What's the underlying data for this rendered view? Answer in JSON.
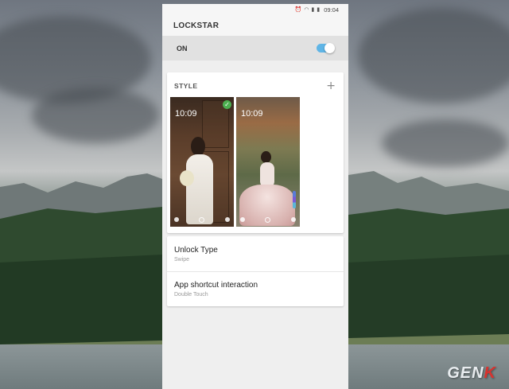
{
  "status_bar": {
    "time": "09:04"
  },
  "app": {
    "title": "LOCKSTAR"
  },
  "master_switch": {
    "label": "ON",
    "enabled": true,
    "accent_color": "#5fb5e6"
  },
  "style": {
    "title": "STYLE",
    "add_icon": "plus-icon",
    "themes": [
      {
        "time": "10:09",
        "selected": true
      },
      {
        "time": "10:09",
        "selected": false
      }
    ]
  },
  "options": [
    {
      "title": "Unlock Type",
      "value": "Swipe"
    },
    {
      "title": "App shortcut interaction",
      "value": "Double Touch"
    }
  ],
  "watermark": {
    "text_main": "GEN",
    "text_accent": "K"
  }
}
